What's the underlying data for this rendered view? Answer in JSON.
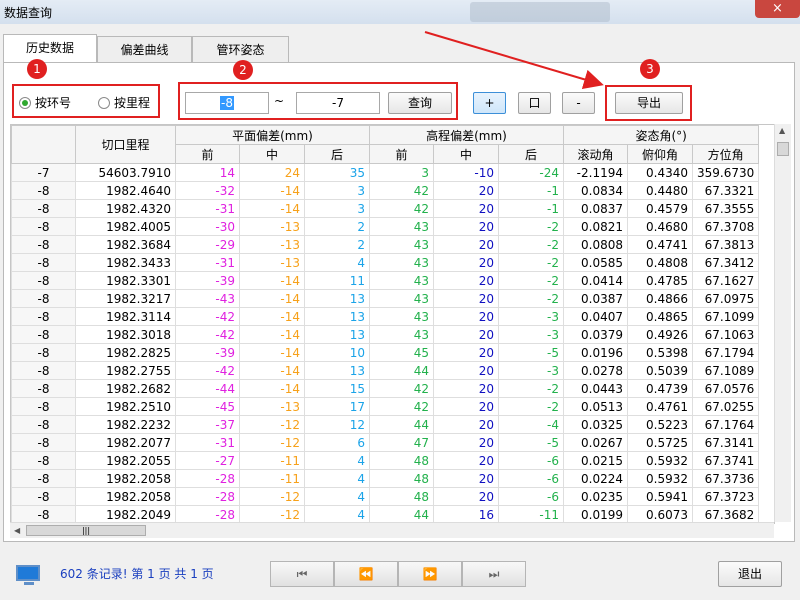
{
  "window": {
    "title": "数据查询",
    "close_icon": "×"
  },
  "tabs": [
    {
      "label": "历史数据",
      "active": true
    },
    {
      "label": "偏差曲线",
      "active": false
    },
    {
      "label": "管环姿态",
      "active": false
    }
  ],
  "annotations": [
    "1",
    "2",
    "3"
  ],
  "query": {
    "radio_ring": "按环号",
    "radio_mileage": "按里程",
    "selected": "按环号",
    "from_value": "-8",
    "tilde": "~",
    "to_value": "-7",
    "query_button": "查询",
    "zoom_in": "+",
    "zoom_box": "口",
    "zoom_out": "-",
    "export_button": "导出"
  },
  "table": {
    "group_headers": {
      "mileage": "切口里程",
      "plane": "平面偏差(mm)",
      "elevation": "高程偏差(mm)",
      "attitude": "姿态角(°)"
    },
    "sub_headers": [
      "前",
      "中",
      "后",
      "前",
      "中",
      "后",
      "滚动角",
      "俯仰角",
      "方位角"
    ],
    "rows": [
      [
        "-7",
        "54603.7910",
        "14",
        "24",
        "35",
        "3",
        "-10",
        "-24",
        "-2.1194",
        "0.4340",
        "359.6730"
      ],
      [
        "-8",
        "1982.4640",
        "-32",
        "-14",
        "3",
        "42",
        "20",
        "-1",
        "0.0834",
        "0.4480",
        "67.3321"
      ],
      [
        "-8",
        "1982.4320",
        "-31",
        "-14",
        "3",
        "42",
        "20",
        "-1",
        "0.0837",
        "0.4579",
        "67.3555"
      ],
      [
        "-8",
        "1982.4005",
        "-30",
        "-13",
        "2",
        "43",
        "20",
        "-2",
        "0.0821",
        "0.4680",
        "67.3708"
      ],
      [
        "-8",
        "1982.3684",
        "-29",
        "-13",
        "2",
        "43",
        "20",
        "-2",
        "0.0808",
        "0.4741",
        "67.3813"
      ],
      [
        "-8",
        "1982.3433",
        "-31",
        "-13",
        "4",
        "43",
        "20",
        "-2",
        "0.0585",
        "0.4808",
        "67.3412"
      ],
      [
        "-8",
        "1982.3301",
        "-39",
        "-14",
        "11",
        "43",
        "20",
        "-2",
        "0.0414",
        "0.4785",
        "67.1627"
      ],
      [
        "-8",
        "1982.3217",
        "-43",
        "-14",
        "13",
        "43",
        "20",
        "-2",
        "0.0387",
        "0.4866",
        "67.0975"
      ],
      [
        "-8",
        "1982.3114",
        "-42",
        "-14",
        "13",
        "43",
        "20",
        "-3",
        "0.0407",
        "0.4865",
        "67.1099"
      ],
      [
        "-8",
        "1982.3018",
        "-42",
        "-14",
        "13",
        "43",
        "20",
        "-3",
        "0.0379",
        "0.4926",
        "67.1063"
      ],
      [
        "-8",
        "1982.2825",
        "-39",
        "-14",
        "10",
        "45",
        "20",
        "-5",
        "0.0196",
        "0.5398",
        "67.1794"
      ],
      [
        "-8",
        "1982.2755",
        "-42",
        "-14",
        "13",
        "44",
        "20",
        "-3",
        "0.0278",
        "0.5039",
        "67.1089"
      ],
      [
        "-8",
        "1982.2682",
        "-44",
        "-14",
        "15",
        "42",
        "20",
        "-2",
        "0.0443",
        "0.4739",
        "67.0576"
      ],
      [
        "-8",
        "1982.2510",
        "-45",
        "-13",
        "17",
        "42",
        "20",
        "-2",
        "0.0513",
        "0.4761",
        "67.0255"
      ],
      [
        "-8",
        "1982.2232",
        "-37",
        "-12",
        "12",
        "44",
        "20",
        "-4",
        "0.0325",
        "0.5223",
        "67.1764"
      ],
      [
        "-8",
        "1982.2077",
        "-31",
        "-12",
        "6",
        "47",
        "20",
        "-5",
        "0.0267",
        "0.5725",
        "67.3141"
      ],
      [
        "-8",
        "1982.2055",
        "-27",
        "-11",
        "4",
        "48",
        "20",
        "-6",
        "0.0215",
        "0.5932",
        "67.3741"
      ],
      [
        "-8",
        "1982.2058",
        "-28",
        "-11",
        "4",
        "48",
        "20",
        "-6",
        "0.0224",
        "0.5932",
        "67.3736"
      ],
      [
        "-8",
        "1982.2058",
        "-28",
        "-12",
        "4",
        "48",
        "20",
        "-6",
        "0.0235",
        "0.5941",
        "67.3723"
      ],
      [
        "-8",
        "1982.2049",
        "-28",
        "-12",
        "4",
        "44",
        "16",
        "-11",
        "0.0199",
        "0.6073",
        "67.3682"
      ]
    ]
  },
  "footer": {
    "status": "602 条记录!  第 1 页 共 1 页",
    "first_icon": "⏮",
    "prev_icon": "⏪",
    "next_icon": "⏩",
    "last_icon": "⏭",
    "exit_button": "退出"
  }
}
